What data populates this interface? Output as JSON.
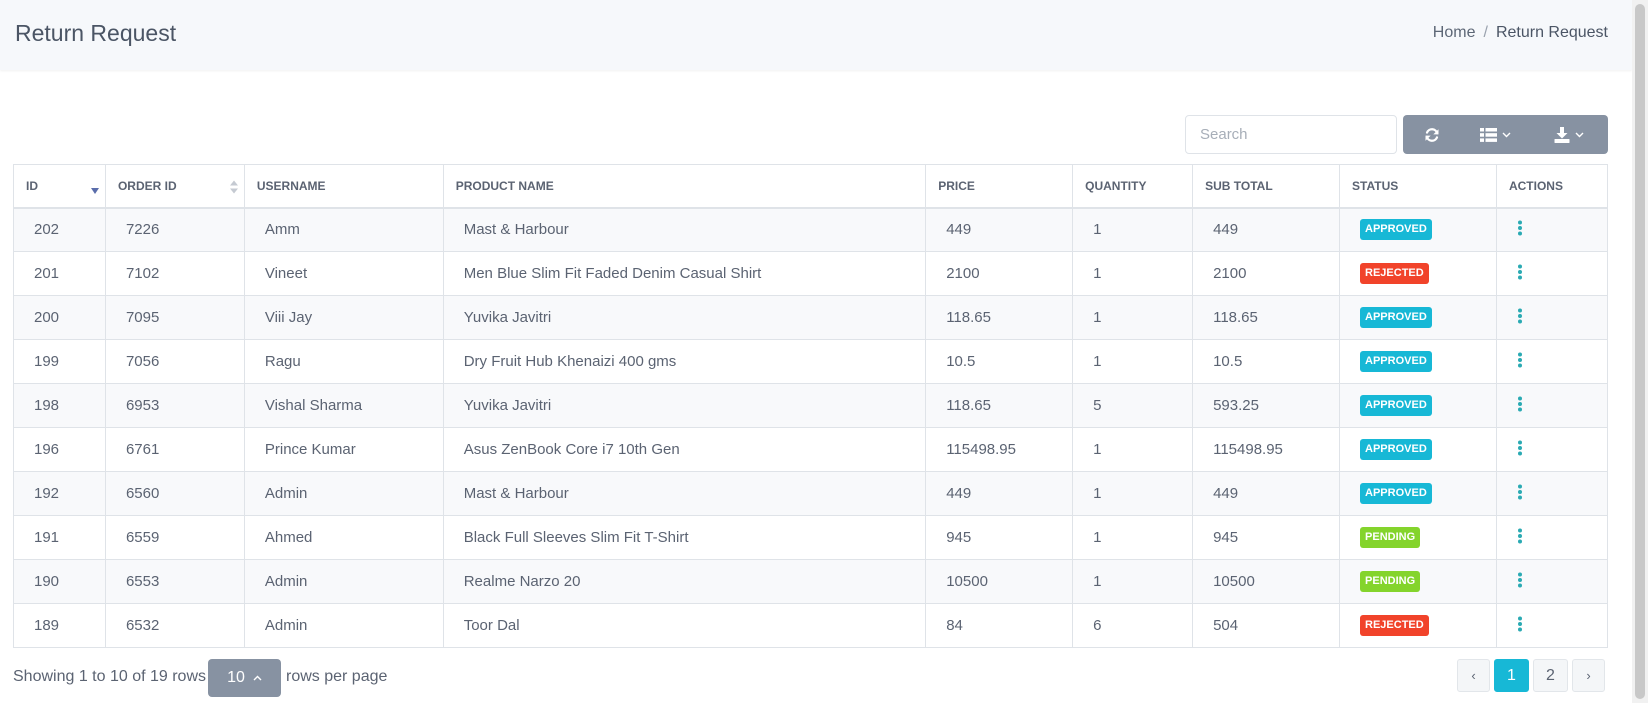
{
  "header": {
    "title": "Return Request"
  },
  "breadcrumb": {
    "home": "Home",
    "separator": "/",
    "current": "Return Request"
  },
  "search": {
    "placeholder": "Search",
    "value": ""
  },
  "toolbar": {
    "icons": [
      "refresh-icon",
      "columns-icon",
      "download-icon"
    ]
  },
  "table": {
    "columns": [
      "ID",
      "ORDER ID",
      "USERNAME",
      "PRODUCT NAME",
      "PRICE",
      "QUANTITY",
      "SUB TOTAL",
      "STATUS",
      "ACTIONS"
    ],
    "rows": [
      [
        "202",
        "7226",
        "Amm",
        "Mast & Harbour",
        "449",
        "1",
        "449",
        "APPROVED"
      ],
      [
        "201",
        "7102",
        "Vineet",
        "Men Blue Slim Fit Faded Denim Casual Shirt",
        "2100",
        "1",
        "2100",
        "REJECTED"
      ],
      [
        "200",
        "7095",
        "Viii Jay",
        "Yuvika Javitri",
        "118.65",
        "1",
        "118.65",
        "APPROVED"
      ],
      [
        "199",
        "7056",
        "Ragu",
        "Dry Fruit Hub Khenaizi 400 gms",
        "10.5",
        "1",
        "10.5",
        "APPROVED"
      ],
      [
        "198",
        "6953",
        "Vishal Sharma",
        "Yuvika Javitri",
        "118.65",
        "5",
        "593.25",
        "APPROVED"
      ],
      [
        "196",
        "6761",
        "Prince Kumar",
        "Asus ZenBook Core i7 10th Gen",
        "115498.95",
        "1",
        "115498.95",
        "APPROVED"
      ],
      [
        "192",
        "6560",
        "Admin",
        "Mast & Harbour",
        "449",
        "1",
        "449",
        "APPROVED"
      ],
      [
        "191",
        "6559",
        "Ahmed",
        "Black Full Sleeves Slim Fit T-Shirt",
        "945",
        "1",
        "945",
        "PENDING"
      ],
      [
        "190",
        "6553",
        "Admin",
        "Realme Narzo 20",
        "10500",
        "1",
        "10500",
        "PENDING"
      ],
      [
        "189",
        "6532",
        "Admin",
        "Toor Dal",
        "84",
        "6",
        "504",
        "REJECTED"
      ]
    ]
  },
  "status_colors": {
    "APPROVED": "#17b8d6",
    "REJECTED": "#f1432a",
    "PENDING": "#84d42c"
  },
  "colors": {
    "accent": "#17b8d6",
    "toolbar": "#8792a2",
    "icon_teal": "#2aaab3"
  },
  "footer": {
    "showing": "Showing 1 to 10 of 19 rows",
    "page_size": "10",
    "rows_per_page": "rows per page"
  },
  "pagination": {
    "prev": "‹",
    "pages": [
      "1",
      "2"
    ],
    "active": "1",
    "next": "›"
  }
}
